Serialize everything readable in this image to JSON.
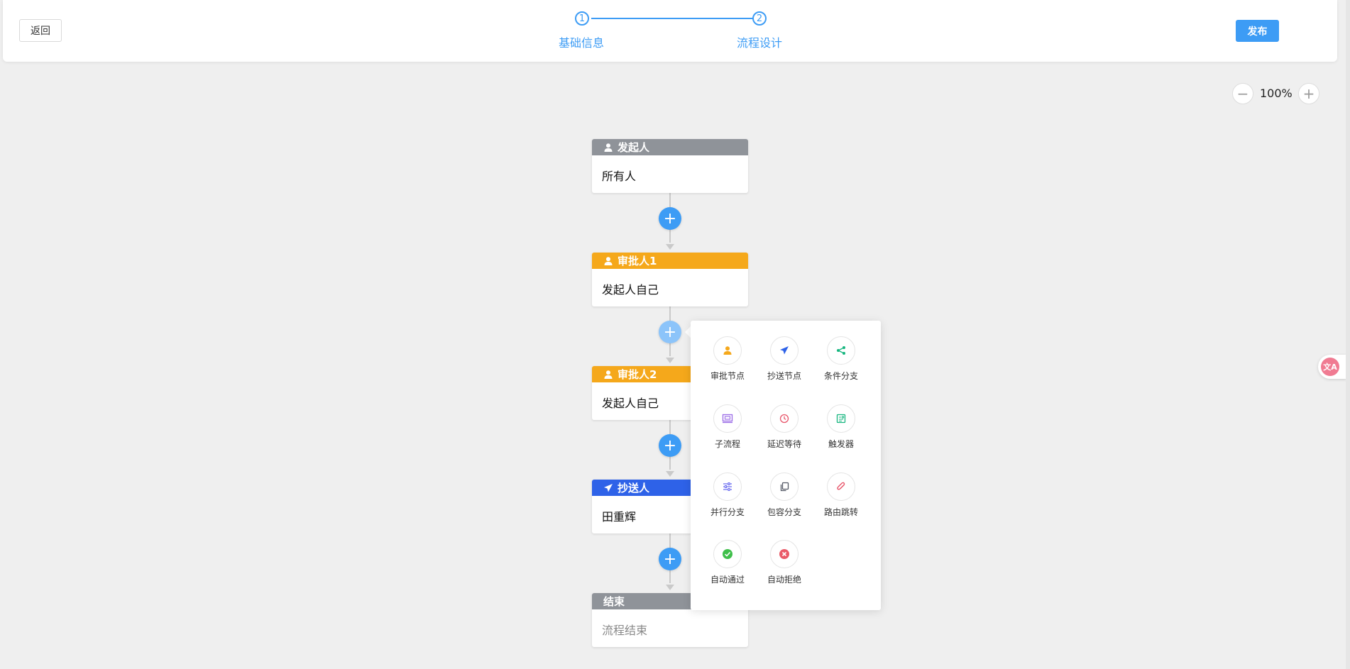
{
  "header": {
    "back_label": "返回",
    "publish_label": "发布",
    "steps": [
      {
        "number": "1",
        "label": "基础信息"
      },
      {
        "number": "2",
        "label": "流程设计"
      }
    ],
    "accent_color": "#3d9cf5"
  },
  "zoom": {
    "level": "100%",
    "minus": "−",
    "plus": "+"
  },
  "flow": {
    "add_symbol": "+",
    "nodes": [
      {
        "title": "发起人",
        "content": "所有人",
        "color": "#8f9399",
        "icon": "user-icon"
      },
      {
        "title": "审批人1",
        "content": "发起人自己",
        "color": "#f5a81b",
        "icon": "user-icon"
      },
      {
        "title": "审批人2",
        "content": "发起人自己",
        "color": "#f5a81b",
        "icon": "user-icon"
      },
      {
        "title": "抄送人",
        "content": "田重辉",
        "color": "#2e62e8",
        "icon": "send-icon"
      },
      {
        "title": "结束",
        "content": "流程结束",
        "color": "#8f9399",
        "icon": ""
      }
    ]
  },
  "popup": {
    "items": [
      {
        "label": "审批节点",
        "icon": "approver-icon",
        "color": "#f5a81b"
      },
      {
        "label": "抄送节点",
        "icon": "send-icon",
        "color": "#2e62e8"
      },
      {
        "label": "条件分支",
        "icon": "share-icon",
        "color": "#16b67f"
      },
      {
        "label": "子流程",
        "icon": "subprocess-icon",
        "color": "#9b6ce6"
      },
      {
        "label": "延迟等待",
        "icon": "clock-icon",
        "color": "#e8566b"
      },
      {
        "label": "触发器",
        "icon": "trigger-icon",
        "color": "#16b67f"
      },
      {
        "label": "并行分支",
        "icon": "sliders-icon",
        "color": "#6b6cf0"
      },
      {
        "label": "包容分支",
        "icon": "copy-icon",
        "color": "#555a66"
      },
      {
        "label": "路由跳转",
        "icon": "paperclip-icon",
        "color": "#e8566b"
      },
      {
        "label": "自动通过",
        "icon": "check-circle-icon",
        "color": "#3fbf4a"
      },
      {
        "label": "自动拒绝",
        "icon": "x-circle-icon",
        "color": "#ea5a68"
      }
    ]
  },
  "translate": {
    "glyph": "文A"
  }
}
